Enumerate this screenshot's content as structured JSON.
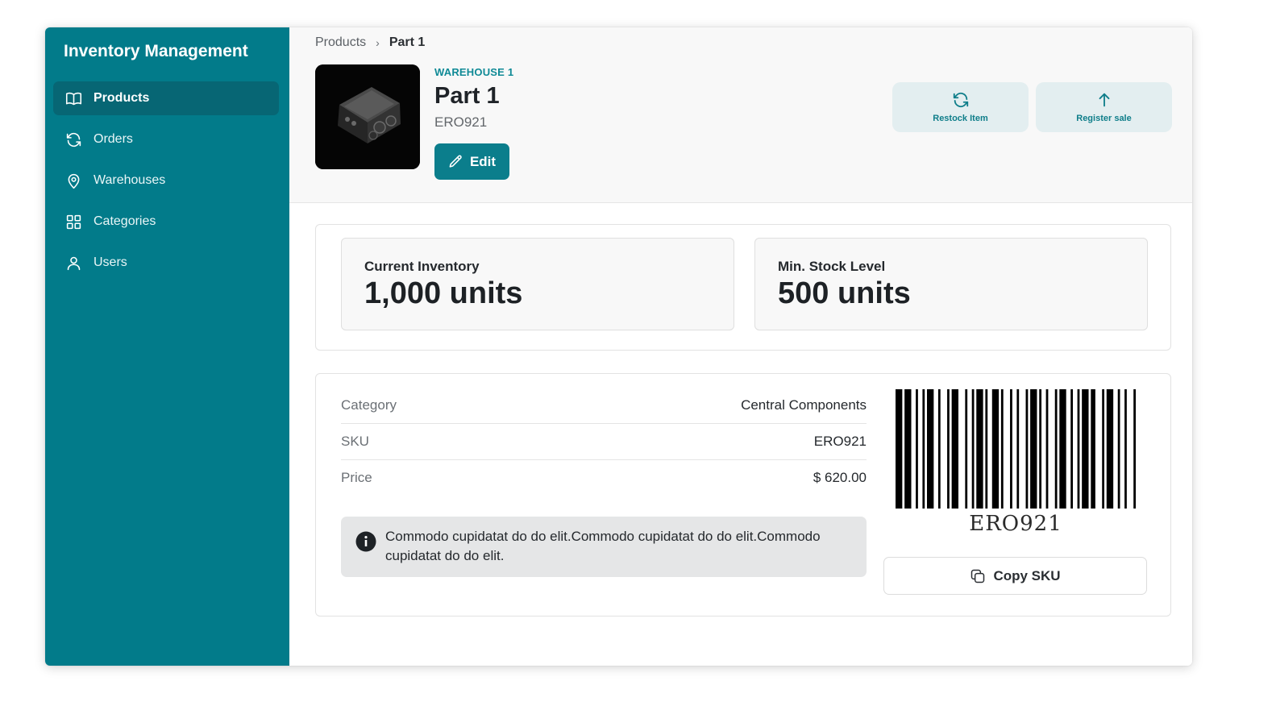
{
  "app": {
    "title": "Inventory Management"
  },
  "sidebar": {
    "items": [
      {
        "label": "Products",
        "icon": "book-icon",
        "active": true
      },
      {
        "label": "Orders",
        "icon": "refresh-icon",
        "active": false
      },
      {
        "label": "Warehouses",
        "icon": "map-pin-icon",
        "active": false
      },
      {
        "label": "Categories",
        "icon": "grid-icon",
        "active": false
      },
      {
        "label": "Users",
        "icon": "user-icon",
        "active": false
      }
    ]
  },
  "breadcrumb": {
    "parent": "Products",
    "separator": "›",
    "current": "Part 1"
  },
  "product": {
    "warehouse": "WAREHOUSE 1",
    "name": "Part 1",
    "code": "ERO921",
    "edit_label": "Edit"
  },
  "actions": {
    "restock_label": "Restock Item",
    "register_label": "Register sale"
  },
  "stats": {
    "current_inventory_label": "Current Inventory",
    "current_inventory_value": "1,000 units",
    "min_stock_label": "Min. Stock Level",
    "min_stock_value": "500 units"
  },
  "details": {
    "rows": [
      {
        "label": "Category",
        "value": "Central Components"
      },
      {
        "label": "SKU",
        "value": "ERO921"
      },
      {
        "label": "Price",
        "value": "$ 620.00"
      }
    ],
    "note": "Commodo cupidatat do do elit.Commodo cupidatat do do elit.Commodo cupidatat do do elit."
  },
  "barcode": {
    "text": "ERO921",
    "copy_label": "Copy SKU"
  },
  "colors": {
    "sidebar": "#027b8a",
    "sidebar_active": "#076674",
    "accent": "#0b7e8c",
    "action_bg": "#e3eef0"
  }
}
